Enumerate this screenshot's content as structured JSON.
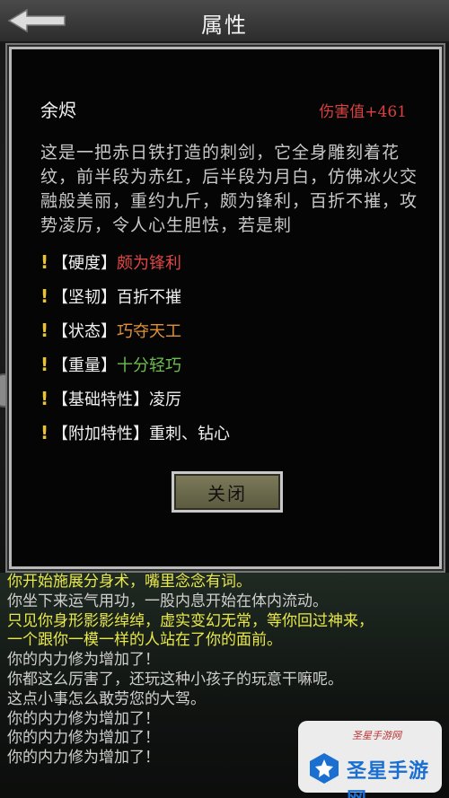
{
  "header": {
    "title": "属性"
  },
  "item": {
    "name": "余烬",
    "damage_label": "伤害值+",
    "damage_value": "461",
    "description": "这是一把赤日铁打造的刺剑，它全身雕刻着花纹，前半段为赤红，后半段为月白，仿佛冰火交融般美丽，重约九斤，颇为锋利，百折不摧，攻势凌厉，令人心生胆怯，若是刺"
  },
  "attributes": [
    {
      "key": "【硬度】",
      "value": "颇为锋利",
      "color": "#e04545"
    },
    {
      "key": "【坚韧】",
      "value": "百折不摧",
      "color": "#f0f0f0"
    },
    {
      "key": "【状态】",
      "value": "巧夺天工",
      "color": "#e0903a"
    },
    {
      "key": "【重量】",
      "value": "十分轻巧",
      "color": "#6bbf4f"
    },
    {
      "key": "【基础特性】",
      "value": "凌厉",
      "color": "#f0f0f0"
    },
    {
      "key": "【附加特性】",
      "value": "重刺、钻心",
      "color": "#f0f0f0"
    }
  ],
  "dialog": {
    "close_label": "关闭"
  },
  "log": [
    {
      "text": "你开始施展分身术，嘴里念念有词。",
      "color": "#e8e84a"
    },
    {
      "text": "你坐下来运气用功，一股内息开始在体内流动。",
      "color": "#cfcfcf"
    },
    {
      "text": "只见你身形影影绰绰，虚实变幻无常，等你回过神来，",
      "color": "#e8e84a"
    },
    {
      "text": "一个跟你一模一样的人站在了你的面前。",
      "color": "#e8e84a"
    },
    {
      "text": "你的内力修为增加了！",
      "color": "#cfcfcf"
    },
    {
      "text": "你都这么厉害了，还玩这种小孩子的玩意干嘛呢。",
      "color": "#cfcfcf"
    },
    {
      "text": "这点小事怎么敢劳您的大驾。",
      "color": "#cfcfcf"
    },
    {
      "text": "你的内力修为增加了！",
      "color": "#cfcfcf"
    },
    {
      "text": "你的内力修为增加了！",
      "color": "#cfcfcf"
    },
    {
      "text": "你的内力修为增加了！",
      "color": "#cfcfcf"
    }
  ],
  "watermark": {
    "brand": "圣星手游网",
    "sub": "圣星手游网"
  }
}
